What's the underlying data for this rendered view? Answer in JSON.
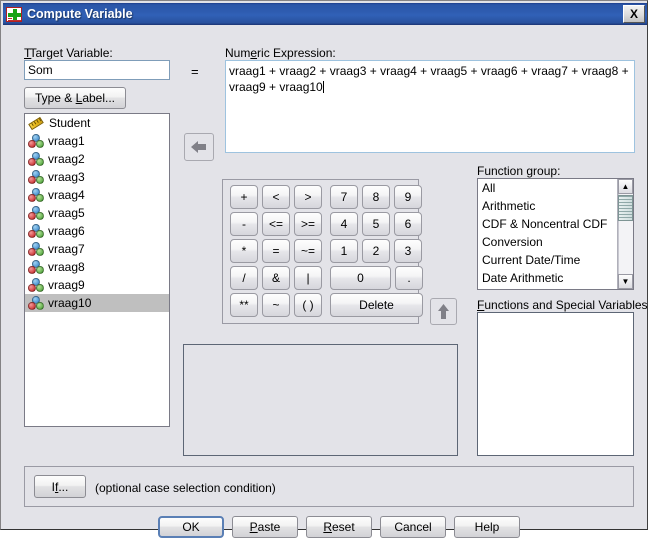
{
  "window": {
    "title": "Compute Variable",
    "icon": "compute-variable-icon",
    "close_label": "X"
  },
  "target_variable": {
    "label": "Target Variable:",
    "label_mnemonic": "T",
    "value": "Som"
  },
  "equals_sign": "=",
  "type_label_button": {
    "label": "Type & Label...",
    "mnemonic": "L"
  },
  "variable_list": {
    "items": [
      {
        "name": "Student",
        "icon": "scale-ruler-icon",
        "selected": false
      },
      {
        "name": "vraag1",
        "icon": "nominal-icon",
        "selected": false
      },
      {
        "name": "vraag2",
        "icon": "nominal-icon",
        "selected": false
      },
      {
        "name": "vraag3",
        "icon": "nominal-icon",
        "selected": false
      },
      {
        "name": "vraag4",
        "icon": "nominal-icon",
        "selected": false
      },
      {
        "name": "vraag5",
        "icon": "nominal-icon",
        "selected": false
      },
      {
        "name": "vraag6",
        "icon": "nominal-icon",
        "selected": false
      },
      {
        "name": "vraag7",
        "icon": "nominal-icon",
        "selected": false
      },
      {
        "name": "vraag8",
        "icon": "nominal-icon",
        "selected": false
      },
      {
        "name": "vraag9",
        "icon": "nominal-icon",
        "selected": false
      },
      {
        "name": "vraag10",
        "icon": "nominal-icon",
        "selected": true
      }
    ]
  },
  "transfer_button": {
    "icon": "arrow-left-icon"
  },
  "numeric_expression": {
    "label": "Numeric Expression:",
    "label_mnemonic": "e",
    "value": "vraag1 + vraag2 + vraag3 + vraag4 + vraag5 + vraag6 + vraag7 + vraag8 + vraag9 + vraag10"
  },
  "keypad": {
    "rows": [
      [
        "+",
        "<",
        ">",
        "7",
        "8",
        "9"
      ],
      [
        "-",
        "<=",
        ">=",
        "4",
        "5",
        "6"
      ],
      [
        "*",
        "=",
        "~=",
        "1",
        "2",
        "3"
      ],
      [
        "/",
        "&",
        "|",
        "0",
        "."
      ],
      [
        "**",
        "~",
        "( )",
        "Delete"
      ]
    ]
  },
  "function_insert_button": {
    "icon": "arrow-up-icon"
  },
  "function_group": {
    "label": "Function group:",
    "label_mnemonic": "g",
    "items": [
      "All",
      "Arithmetic",
      "CDF & Noncentral CDF",
      "Conversion",
      "Current Date/Time",
      "Date Arithmetic"
    ],
    "scrollbar": {
      "up": "▲",
      "down": "▼"
    }
  },
  "functions_special_variables": {
    "label": "Functions and Special Variables:",
    "label_mnemonic": "F",
    "items": []
  },
  "if_section": {
    "button_label": "If...",
    "button_mnemonic": "f",
    "hint": "(optional case selection condition)"
  },
  "dialog_buttons": [
    {
      "label": "OK",
      "default": true,
      "mnemonic": ""
    },
    {
      "label": "Paste",
      "default": false,
      "mnemonic": "P"
    },
    {
      "label": "Reset",
      "default": false,
      "mnemonic": "R"
    },
    {
      "label": "Cancel",
      "default": false,
      "mnemonic": ""
    },
    {
      "label": "Help",
      "default": false,
      "mnemonic": ""
    }
  ],
  "colors": {
    "titlebar_blue": "#2e5cb0",
    "dialog_face": "#e3e3e8",
    "selection_grey": "#bfbfbf",
    "field_border_blue": "#7f9db9"
  }
}
